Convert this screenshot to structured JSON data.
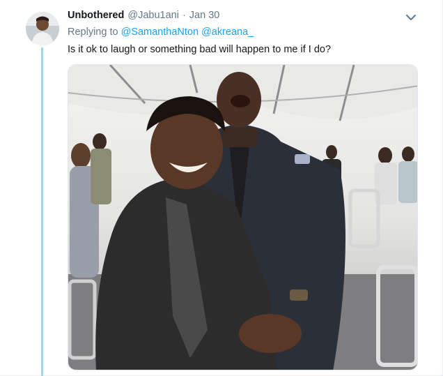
{
  "tweet": {
    "author_name": "Unbothered",
    "author_handle": "@Jabu1ani",
    "separator": "·",
    "date": "Jan 30",
    "replying_label": "Replying to",
    "mentions": [
      "@SamanthaNton",
      "@akreana_"
    ],
    "text": "Is it ok to laugh or something bad will happen to me if I do?",
    "icons": {
      "avatar": "profile-photo",
      "menu": "chevron-down-icon"
    },
    "media": {
      "description_kind": "photo"
    }
  },
  "colors": {
    "link": "#1da1f2",
    "secondary_text": "#657786",
    "thread_line": "#9ed3f0"
  }
}
